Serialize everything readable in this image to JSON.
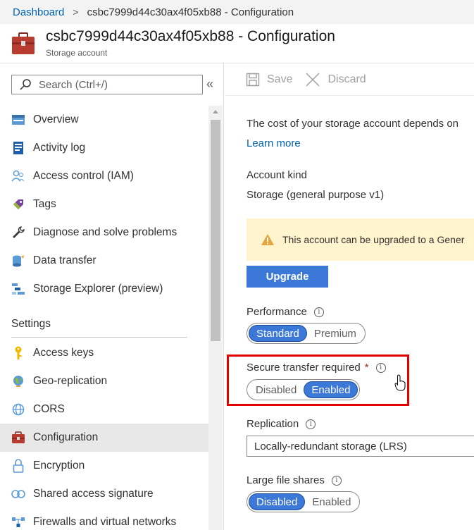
{
  "breadcrumb": {
    "home": "Dashboard",
    "separator": ">",
    "current": "csbc7999d44c30ax4f05xb88 - Configuration"
  },
  "header": {
    "title": "csbc7999d44c30ax4f05xb88 - Configuration",
    "subtitle": "Storage account",
    "icon": "storage-account-icon"
  },
  "sidebar": {
    "search_placeholder": "Search (Ctrl+/)",
    "collapse": "«",
    "items": [
      {
        "label": "Overview",
        "icon": "overview-icon"
      },
      {
        "label": "Activity log",
        "icon": "activity-log-icon"
      },
      {
        "label": "Access control (IAM)",
        "icon": "iam-icon"
      },
      {
        "label": "Tags",
        "icon": "tag-icon"
      },
      {
        "label": "Diagnose and solve problems",
        "icon": "wrench-icon"
      },
      {
        "label": "Data transfer",
        "icon": "data-transfer-icon"
      },
      {
        "label": "Storage Explorer (preview)",
        "icon": "storage-explorer-icon"
      }
    ],
    "settings_header": "Settings",
    "settings_items": [
      {
        "label": "Access keys",
        "icon": "key-icon"
      },
      {
        "label": "Geo-replication",
        "icon": "globe-icon"
      },
      {
        "label": "CORS",
        "icon": "cors-icon"
      },
      {
        "label": "Configuration",
        "icon": "configuration-icon",
        "selected": true
      },
      {
        "label": "Encryption",
        "icon": "lock-icon"
      },
      {
        "label": "Shared access signature",
        "icon": "link-icon"
      },
      {
        "label": "Firewalls and virtual networks",
        "icon": "firewall-icon"
      }
    ]
  },
  "toolbar": {
    "save": "Save",
    "discard": "Discard"
  },
  "main": {
    "description": "The cost of your storage account depends on",
    "learn_more": "Learn more",
    "account_kind_label": "Account kind",
    "account_kind_value": "Storage (general purpose v1)",
    "warning": "This account can be upgraded to a Gener",
    "upgrade_button": "Upgrade",
    "performance": {
      "label": "Performance",
      "options": [
        "Standard",
        "Premium"
      ],
      "selected": "Standard"
    },
    "secure_transfer": {
      "label": "Secure transfer required",
      "required_mark": "*",
      "options": [
        "Disabled",
        "Enabled"
      ],
      "selected": "Enabled"
    },
    "replication": {
      "label": "Replication",
      "value": "Locally-redundant storage (LRS)"
    },
    "large_file_shares": {
      "label": "Large file shares",
      "options": [
        "Disabled",
        "Enabled"
      ],
      "selected": "Disabled"
    },
    "info_glyph": "i"
  },
  "colors": {
    "accent": "#3b78d8",
    "link": "#0063b1",
    "highlight": "#e00000",
    "warning_bg": "#fff4ce"
  }
}
